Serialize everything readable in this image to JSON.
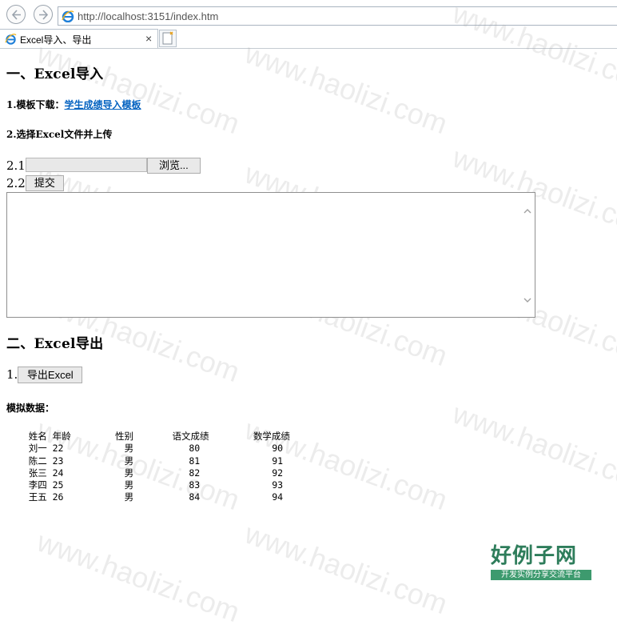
{
  "browser": {
    "url": "http://localhost:3151/index.htm",
    "tab_title": "Excel导入、导出",
    "tab_close": "×"
  },
  "import_section": {
    "heading": "一、Excel导入",
    "template_label": "1.模板下载：",
    "template_link": "学生成绩导入模板",
    "choose_label": "2.选择Excel文件并上传",
    "file_row_label": "2.1",
    "browse_button": "浏览...",
    "submit_row_label": "2.2",
    "submit_button": "提交"
  },
  "export_section": {
    "heading": "二、Excel导出",
    "export_row_label": "1.",
    "export_button": "导出Excel",
    "mock_label": "模拟数据：",
    "mock_data": "    姓名 年龄        性别       语文成绩        数学成绩\n    刘一 22           男          80             90\n    陈二 23           男          81             91\n    张三 24           男          82             92\n    李四 25           男          83             93\n    王五 26           男          84             94"
  },
  "watermark": "www.haolizi.com",
  "logo": {
    "title": "好例子网",
    "subtitle": "开发实例分享交流平台"
  }
}
